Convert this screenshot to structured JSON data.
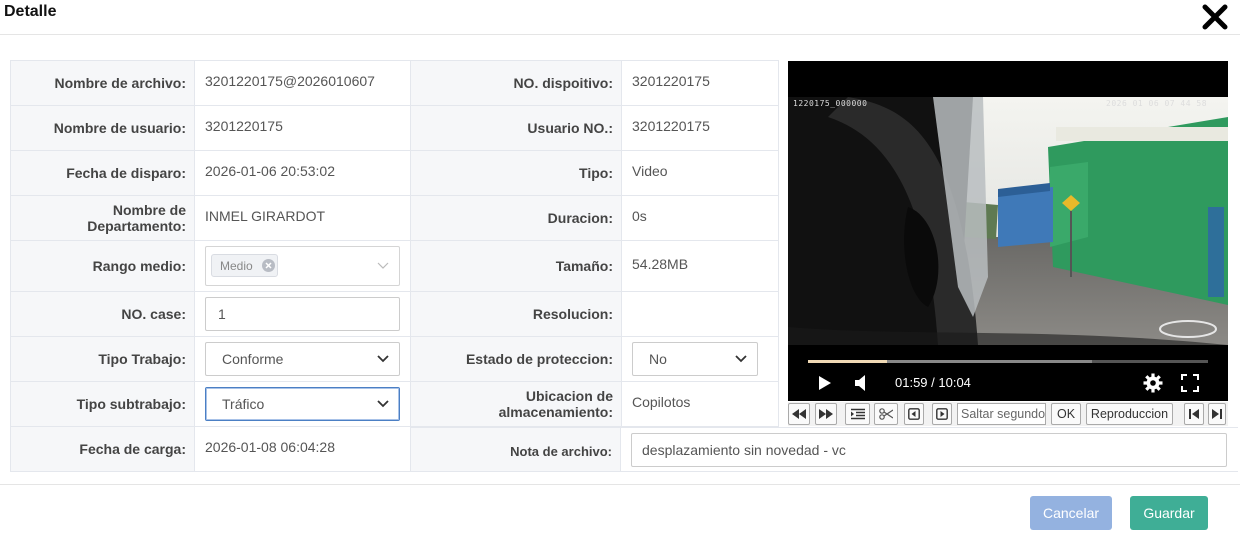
{
  "dialog": {
    "title": "Detalle",
    "close_icon": "close-icon"
  },
  "fields": {
    "file_name": {
      "label": "Nombre de archivo:",
      "value": "3201220175@2026010607"
    },
    "device_no": {
      "label": "NO. dispoitivo:",
      "value": "3201220175"
    },
    "user_name": {
      "label": "Nombre de usuario:",
      "value": "3201220175"
    },
    "user_no": {
      "label": "Usuario NO.:",
      "value": "3201220175"
    },
    "shot_date": {
      "label": "Fecha de disparo:",
      "value": "2026-01-06 20:53:02"
    },
    "type": {
      "label": "Tipo:",
      "value": "Video"
    },
    "department": {
      "label": "Nombre de Departamento:",
      "value": "INMEL GIRARDOT"
    },
    "duration": {
      "label": "Duracion:",
      "value": "0s"
    },
    "media_range": {
      "label": "Rango medio:",
      "tag": "Medio"
    },
    "size": {
      "label": "Tamaño:",
      "value": "54.28MB"
    },
    "case_no": {
      "label": "NO. case:",
      "value": "1"
    },
    "resolution": {
      "label": "Resolucion:",
      "value": ""
    },
    "work_type": {
      "label": "Tipo Trabajo:",
      "value": "Conforme"
    },
    "protection": {
      "label": "Estado de proteccion:",
      "value": "No"
    },
    "sub_work_type": {
      "label": "Tipo subtrabajo:",
      "value": "Tráfico"
    },
    "storage": {
      "label": "Ubicacion de almacenamiento:",
      "value": "Copilotos"
    },
    "upload_date": {
      "label": "Fecha de carga:",
      "value": "2026-01-08 06:04:28"
    },
    "file_note": {
      "label": "Nota de archivo:",
      "value": "desplazamiento sin novedad - vc"
    }
  },
  "video": {
    "osd_left": "1220175_000000",
    "osd_right": "2026 01 06 07 44 58",
    "time": "01:59 / 10:04",
    "played_fraction": 0.198,
    "buffered_fraction": 0.71,
    "icons": [
      "play-icon",
      "volume-icon",
      "settings-icon",
      "fullscreen-icon"
    ]
  },
  "toolbar": {
    "seek_placeholder": "Saltar segundo",
    "ok_label": "OK",
    "play_label": "Reproduccion",
    "icons": [
      "rewind-icon",
      "fast-forward-icon",
      "list-icon",
      "scissors-icon",
      "prev-frame-icon",
      "next-frame-icon",
      "skip-start-icon",
      "skip-end-icon"
    ]
  },
  "footer": {
    "cancel_label": "Cancelar",
    "save_label": "Guardar"
  },
  "colors": {
    "cancel": "#94b2e0",
    "save": "#3fae96",
    "label_bg": "#f6f7f9",
    "focus_border": "#4b7fc4"
  }
}
